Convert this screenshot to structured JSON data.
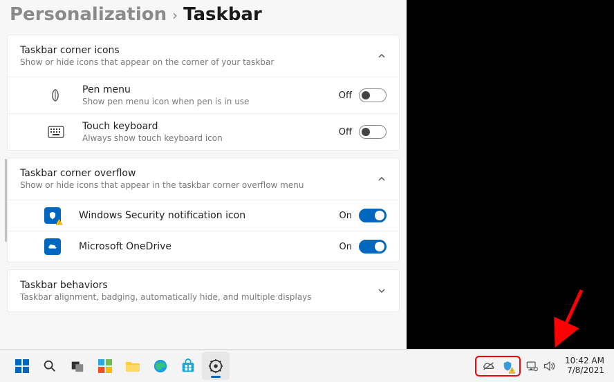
{
  "breadcrumb": {
    "parent": "Personalization",
    "leaf": "Taskbar"
  },
  "sections": {
    "cornerIcons": {
      "title": "Taskbar corner icons",
      "subtitle": "Show or hide icons that appear on the corner of your taskbar",
      "items": [
        {
          "title": "Pen menu",
          "subtitle": "Show pen menu icon when pen is in use",
          "state": "Off"
        },
        {
          "title": "Touch keyboard",
          "subtitle": "Always show touch keyboard icon",
          "state": "Off"
        }
      ]
    },
    "overflow": {
      "title": "Taskbar corner overflow",
      "subtitle": "Show or hide icons that appear in the taskbar corner overflow menu",
      "items": [
        {
          "title": "Windows Security notification icon",
          "state": "On"
        },
        {
          "title": "Microsoft OneDrive",
          "state": "On"
        }
      ]
    },
    "behaviors": {
      "title": "Taskbar behaviors",
      "subtitle": "Taskbar alignment, badging, automatically hide, and multiple displays"
    }
  },
  "system": {
    "time": "10:42 AM",
    "date": "7/8/2021"
  }
}
